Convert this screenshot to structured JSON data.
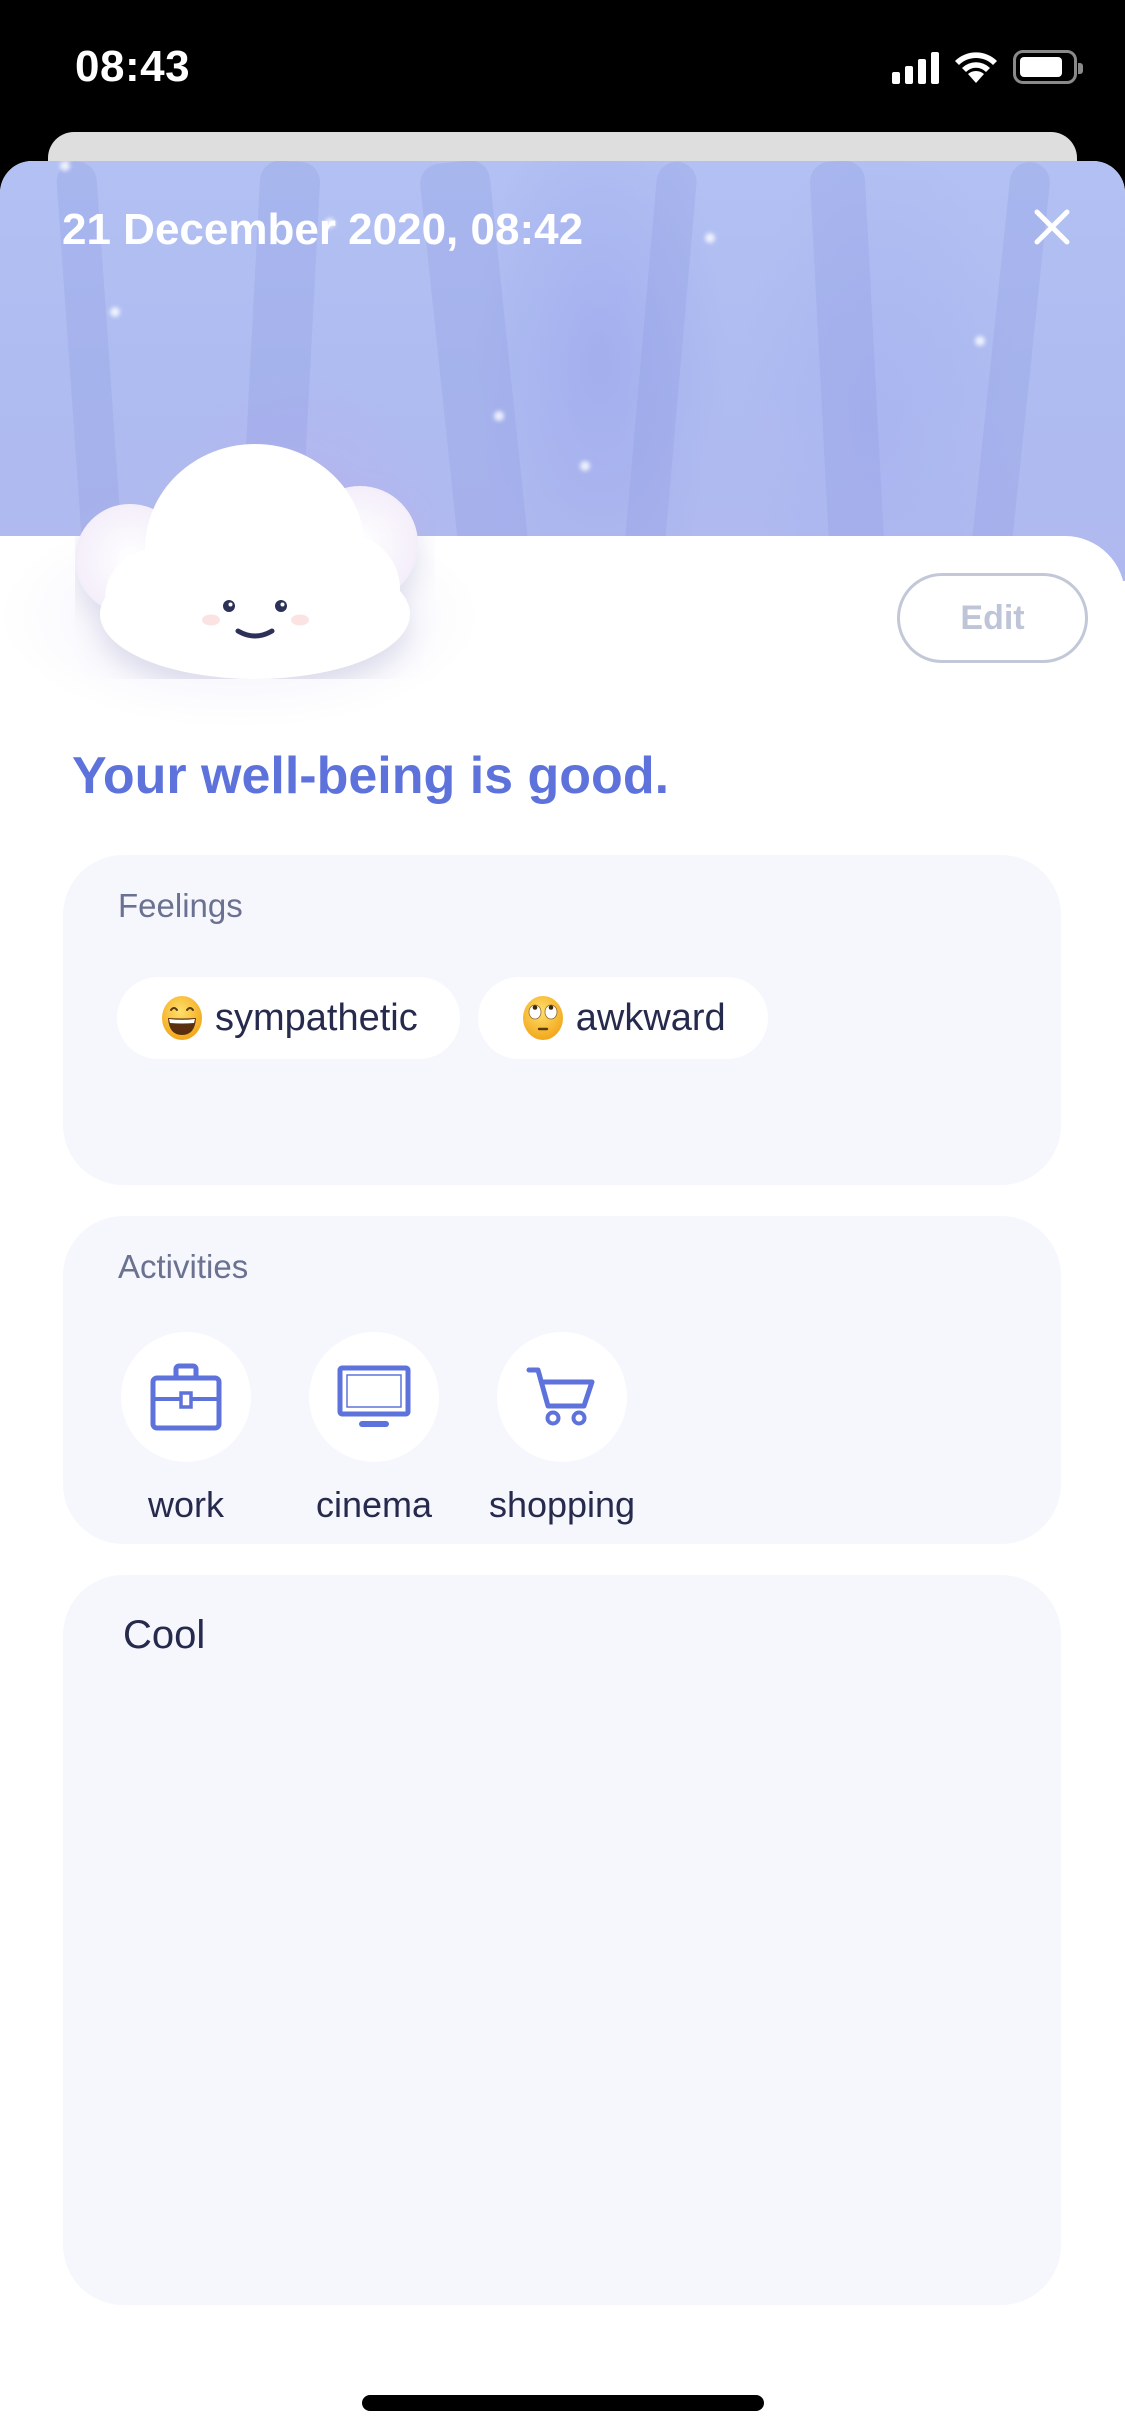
{
  "status_bar": {
    "time": "08:43",
    "icons": [
      "cellular-signal-icon",
      "wifi-icon",
      "battery-icon"
    ]
  },
  "header": {
    "title": "21 December 2020, 08:42",
    "close_icon": "close-icon"
  },
  "mood": {
    "avatar": "smiling-cloud",
    "summary": "Your well-being is good.",
    "edit_label": "Edit"
  },
  "feelings": {
    "label": "Feelings",
    "items": [
      {
        "emoji": "grinning-face-with-smiling-eyes",
        "label": "sympathetic"
      },
      {
        "emoji": "face-with-rolling-eyes",
        "label": "awkward"
      }
    ]
  },
  "activities": {
    "label": "Activities",
    "items": [
      {
        "icon": "briefcase-icon",
        "label": "work"
      },
      {
        "icon": "monitor-icon",
        "label": "cinema"
      },
      {
        "icon": "shopping-cart-icon",
        "label": "shopping"
      }
    ]
  },
  "note": {
    "text": "Cool"
  },
  "colors": {
    "accent": "#5e72dc",
    "hero_bg": "#b0bdf2",
    "card_bg": "#f6f7fd",
    "text_dark": "#262a4d",
    "label_gray": "#6b7190",
    "edit_border": "#c3c8d9"
  }
}
